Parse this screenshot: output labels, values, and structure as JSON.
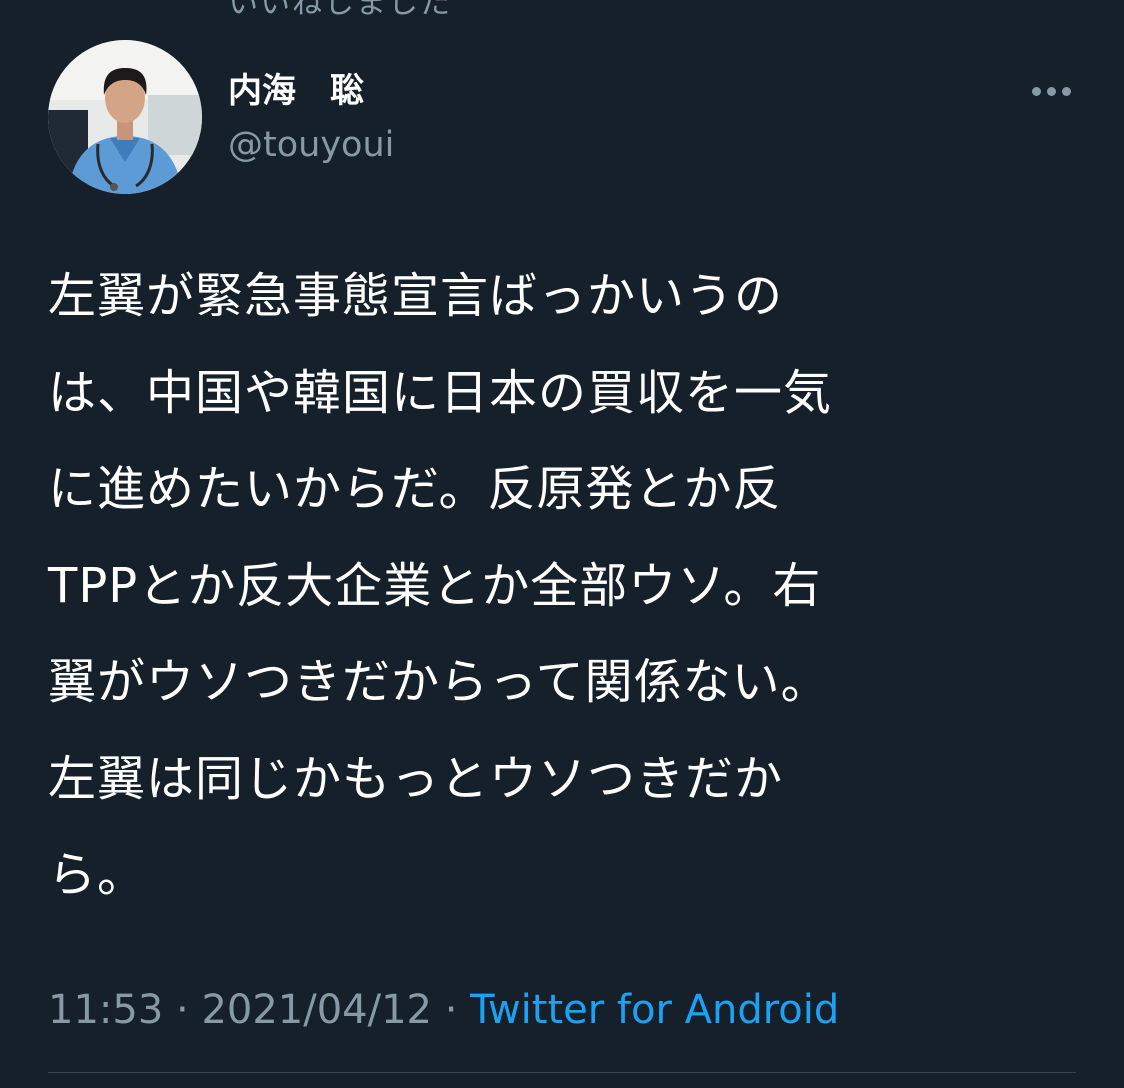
{
  "header": {
    "partial_text": "いいねしました"
  },
  "author": {
    "name": "内海　聡",
    "handle": "@touyoui",
    "avatar": "doctor-avatar"
  },
  "menu": {
    "icon": "more-dots-icon"
  },
  "tweet": {
    "lines": [
      "左翼が緊急事態宣言ばっかいうの",
      "は、中国や韓国に日本の買収を一気",
      "に進めたいからだ。反原発とか反",
      "TPPとか反大企業とか全部ウソ。右",
      "翼がウソつきだからって関係ない。",
      "左翼は同じかもっとウソつきだか",
      "ら。"
    ]
  },
  "meta": {
    "time": "11:53",
    "separator": " · ",
    "date": "2021/04/12",
    "source": "Twitter for Android"
  },
  "colors": {
    "background": "#15202b",
    "text": "#ffffff",
    "secondary": "#8899a6",
    "link": "#1da1f2",
    "divider": "#38444d"
  }
}
